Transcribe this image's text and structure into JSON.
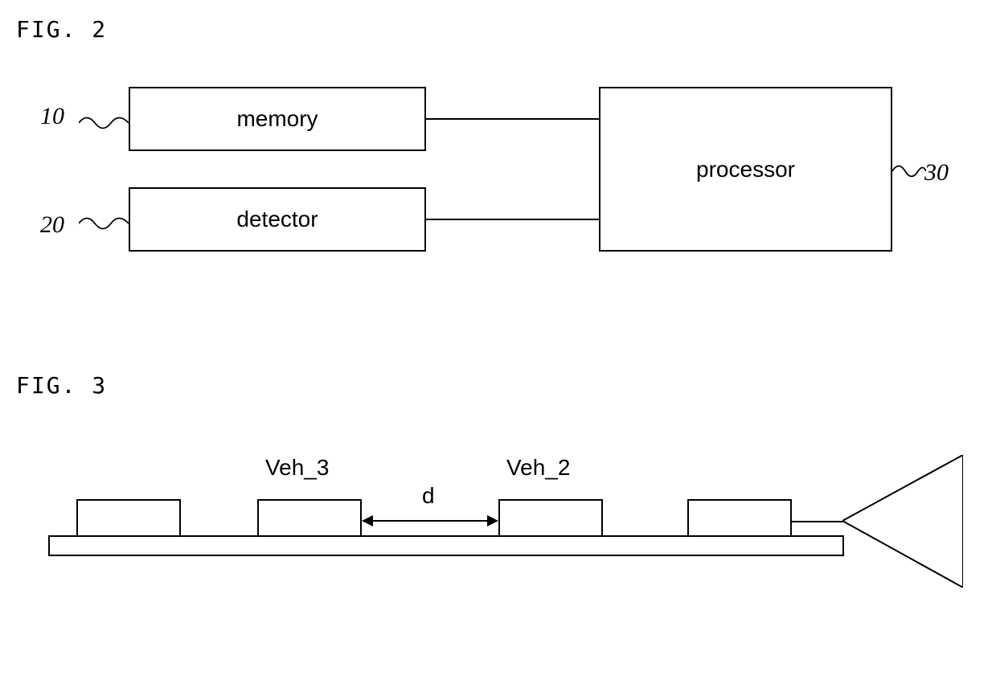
{
  "fig2": {
    "title": "FIG. 2",
    "memory": {
      "label": "memory",
      "ref": "10"
    },
    "detector": {
      "label": "detector",
      "ref": "20"
    },
    "processor": {
      "label": "processor",
      "ref": "30"
    }
  },
  "fig3": {
    "title": "FIG. 3",
    "vehicles": [
      {
        "id": "veh1",
        "label": ""
      },
      {
        "id": "veh3",
        "label": "Veh_3"
      },
      {
        "id": "veh2",
        "label": "Veh_2"
      },
      {
        "id": "veh4",
        "label": ""
      }
    ],
    "distance_label": "d"
  }
}
